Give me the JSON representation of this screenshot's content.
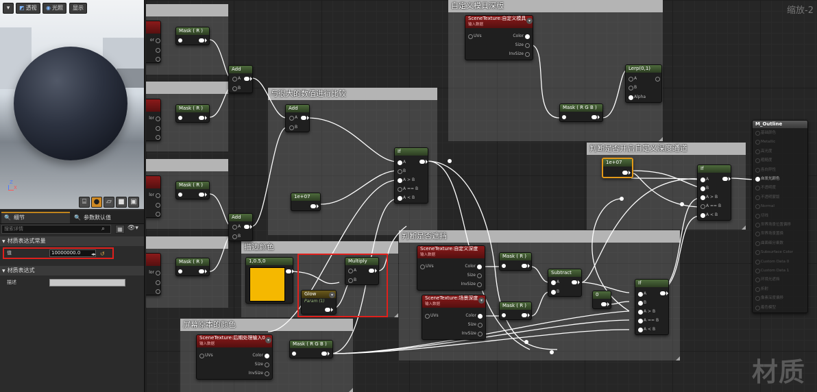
{
  "viewport": {
    "menu_icon": "menu-arrow-icon",
    "perspective_label": "透视",
    "lit_label": "光照",
    "show_label": "显示",
    "axes": {
      "z": "Z",
      "x": "X"
    },
    "preview_shapes": [
      "cylinder-icon",
      "sphere-icon",
      "plane-icon",
      "cube-icon",
      "custom-mesh-icon"
    ]
  },
  "details": {
    "tab_details": "细节",
    "tab_params": "参数默认值",
    "search_placeholder": "搜索详情",
    "section_constant": "材质表达式常量",
    "value_label": "值",
    "value": "10000000.0",
    "section_expression": "材质表达式",
    "desc_label": "描述"
  },
  "graph": {
    "zoom_label": "缩放-2",
    "watermark": "材质",
    "comments": {
      "custom_depth_template": "自定义模具深版",
      "compare_large": "与很大的数值进行比较",
      "custom_depth_enabled": "判断是否开启自定义深度通道",
      "outline_color": "描边颜色",
      "occlusion": "判断是否遮挡",
      "original_color": "屏幕原本的颜色"
    },
    "nodes": {
      "mask_r_1": "Mask ( R )",
      "mask_r_2": "Mask ( R )",
      "mask_r_3": "Mask ( R )",
      "mask_r_4": "Mask ( R )",
      "add_1": "Add",
      "add_2": "Add",
      "add_3": "Add",
      "if_1": "If",
      "if_2": "If",
      "if_3": "If",
      "const_1e07_a": "1e+07",
      "const_1e07_b": "1e+07",
      "const_0": "0",
      "vec_color": "1,0.5,0",
      "multiply": "Multiply",
      "glow": "Glow",
      "glow_sub": "Param (1)",
      "mask_rgb_1": "Mask ( R G B )",
      "mask_rgb_2": "Mask ( R G B )",
      "lerp": "Lerp(0,1)",
      "subtract": "Subtract",
      "mask_r_5": "Mask ( R )",
      "mask_r_6": "Mask ( R )",
      "scene_custom_stencil": "SceneTexture:自定义模具",
      "scene_custom_depth": "SceneTexture:自定义深度",
      "scene_depth": "SceneTexture:场景深度",
      "scene_post": "SceneTexture:后期处理输入0",
      "input_data": "输入数据"
    },
    "pins": {
      "a": "A",
      "b": "B",
      "alpha": "Alpha",
      "a_gt_b": "A > B",
      "a_eq_b": "A == B",
      "a_lt_b": "A < B",
      "uvs": "UVs",
      "color": "Color",
      "size": "Size",
      "invsize": "InvSize",
      "side_or": "or",
      "side_lor": "lor"
    },
    "result_node": {
      "title": "M_Outline",
      "pins": [
        "基础颜色",
        "Metallic",
        "高光度",
        "粗糙度",
        "各向异性",
        "自发光颜色",
        "不透明度",
        "不透明蒙版",
        "Normal",
        "切线",
        "世界场景位置偏移",
        "世界场景置换",
        "曲面细分乘数",
        "Subsurface Color",
        "Custom Data 0",
        "Custom Data 1",
        "环境光遮挡",
        "折射",
        "像素深度偏移",
        "着色模型"
      ],
      "active_index": 5
    }
  }
}
